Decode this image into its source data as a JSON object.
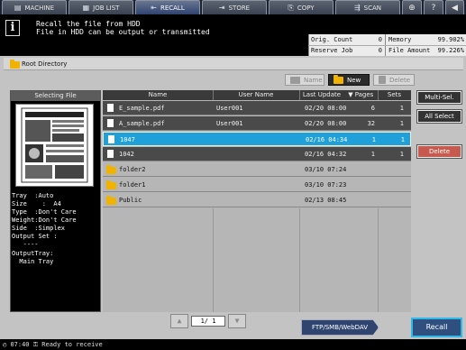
{
  "tabs": {
    "machine": "MACHINE",
    "job_list": "JOB LIST",
    "recall": "RECALL",
    "store": "STORE",
    "copy": "COPY",
    "scan": "SCAN"
  },
  "message": {
    "line1": "Recall the file from HDD",
    "line2": "File in HDD can be output or transmitted"
  },
  "counters": {
    "orig_count_label": "Orig. Count",
    "orig_count_value": "0",
    "memory_label": "Memory",
    "memory_value": "99.902%",
    "reserve_job_label": "Reserve Job",
    "reserve_job_value": "0",
    "file_amount_label": "File Amount",
    "file_amount_value": "99.226%"
  },
  "directory": "Root Directory",
  "top_buttons": {
    "name": "Name",
    "new": "New",
    "delete": "Delete"
  },
  "selecting_file": {
    "title": "Selecting File",
    "info_lines": [
      "Tray  :Auto",
      "Size    :  A4",
      "Type  :Don't Care",
      "Weight:Don't Care",
      "Side  :Simplex",
      "Output Set :",
      "   ----",
      "OutputTray:",
      "  Main Tray"
    ]
  },
  "table": {
    "headers": {
      "name": "Name",
      "user_name": "User Name",
      "last_update": "Last Update",
      "pages": "Pages",
      "sets": "Sets"
    },
    "rows": [
      {
        "name": "E_sample.pdf",
        "user": "User001",
        "update": "02/20 08:00",
        "pages": "6",
        "sets": "1"
      },
      {
        "name": "A_sample.pdf",
        "user": "User001",
        "update": "02/20 08:00",
        "pages": "32",
        "sets": "1"
      },
      {
        "name": "1047",
        "user": "",
        "update": "02/16 04:34",
        "pages": "1",
        "sets": "1"
      },
      {
        "name": "1042",
        "user": "",
        "update": "02/16 04:32",
        "pages": "1",
        "sets": "1"
      },
      {
        "name": "folder2",
        "user": "",
        "update": "03/10 07:24",
        "pages": "",
        "sets": ""
      },
      {
        "name": "folder1",
        "user": "",
        "update": "03/10 07:23",
        "pages": "",
        "sets": ""
      },
      {
        "name": "Public",
        "user": "",
        "update": "02/13 08:45",
        "pages": "",
        "sets": ""
      }
    ]
  },
  "right_buttons": {
    "multi_sel": "Multi-Sel.",
    "all_select": "All Select",
    "delete": "Delete"
  },
  "pager": {
    "current": "1/",
    "total": "1"
  },
  "ftp_button": "FTP/SMB/WebDAV",
  "recall_button": "Recall",
  "status": {
    "time": "07:40",
    "text": "Ready to receive"
  }
}
